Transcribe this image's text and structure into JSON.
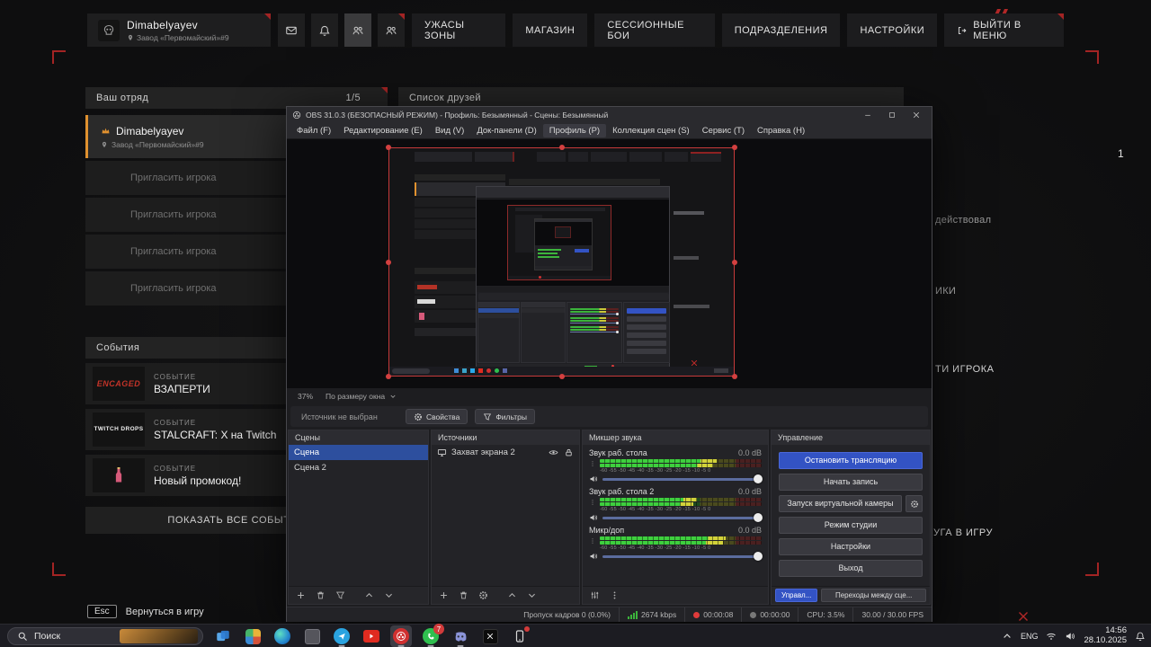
{
  "game": {
    "player_card": {
      "name": "Dimabelyayev",
      "location": "Завод «Первомайский»#9"
    },
    "top_nav": {
      "items": [
        "УЖАСЫ ЗОНЫ",
        "МАГАЗИН",
        "СЕССИОННЫЕ БОИ",
        "ПОДРАЗДЕЛЕНИЯ",
        "НАСТРОЙКИ",
        "ВЫЙТИ В МЕНЮ"
      ]
    },
    "squad": {
      "title": "Ваш отряд",
      "count": "1/5",
      "leader_name": "Dimabelyayev",
      "leader_location": "Завод «Первомайский»#9",
      "invite_label": "Пригласить игрока"
    },
    "friends_title": "Список друзей",
    "events": {
      "title": "События",
      "kind_label": "СОБЫТИЕ",
      "items": [
        {
          "badge": "ENCAGED",
          "title": "ВЗАПЕРТИ"
        },
        {
          "badge": "TWITCH DROPS",
          "title": "STALCRAFT: X на Twitch"
        },
        {
          "badge": "",
          "title": "Новый промокод!"
        }
      ],
      "show_all_label": "ПОКАЗАТЬ ВСЕ СОБЫТИЯ"
    },
    "fragments": {
      "friend_status": "действовал",
      "counter": "1",
      "tab_fragment": "ИКИ",
      "find_player": "ТИ ИГРОКА",
      "add_friend": "УГА В ИГРУ"
    },
    "footer": {
      "esc_key": "Esc",
      "return_label": "Вернуться в игру"
    }
  },
  "obs": {
    "window_title": "OBS 31.0.3 (БЕЗОПАСНЫЙ РЕЖИМ) - Профиль: Безымянный - Сцены: Безымянный",
    "menu": {
      "items": [
        "Файл (F)",
        "Редактирование (E)",
        "Вид (V)",
        "Док-панели (D)",
        "Профиль (P)",
        "Коллекция сцен (S)",
        "Сервис (T)",
        "Справка (H)"
      ]
    },
    "preview": {
      "zoom": "37%",
      "zoom_mode": "По размеру окна"
    },
    "source_toolbar": {
      "hint": "Источник не выбран",
      "properties_label": "Свойства",
      "filters_label": "Фильтры"
    },
    "scenes": {
      "title": "Сцены",
      "items": [
        "Сцена",
        "Сцена 2"
      ]
    },
    "sources": {
      "title": "Источники",
      "items": [
        "Захват экрана 2"
      ]
    },
    "mixer": {
      "title": "Микшер звука",
      "scale": "-60   -55   -50   -45   -40   -35   -30   -25   -20   -15   -10   -5    0",
      "channels": [
        {
          "name": "Звук раб. стола",
          "db": "0.0 dB"
        },
        {
          "name": "Звук раб. стола 2",
          "db": "0.0 dB"
        },
        {
          "name": "Микр/доп",
          "db": "0.0 dB"
        }
      ]
    },
    "controls": {
      "title": "Управление",
      "stop_stream": "Остановить трансляцию",
      "start_record": "Начать запись",
      "virtual_cam": "Запуск виртуальной камеры",
      "studio_mode": "Режим студии",
      "settings": "Настройки",
      "exit": "Выход",
      "manage": "Управл...",
      "transitions": "Переходы между сце..."
    },
    "status_bar": {
      "dropped_frames": "Пропуск кадров 0 (0.0%)",
      "bitrate": "2674 kbps",
      "stream_time": "00:00:08",
      "record_time": "00:00:00",
      "cpu": "CPU: 3.5%",
      "fps": "30.00 / 30.00 FPS"
    }
  },
  "taskbar": {
    "search_label": "Поиск",
    "whatsapp_badge": "7",
    "tray": {
      "lang": "ENG",
      "time": "14:56",
      "date": "28.10.2025"
    }
  },
  "colors": {
    "accent_orange": "#e0912f",
    "accent_red": "#a32424",
    "obs_blue": "#3353c4",
    "meter_green": "#3ecf3e",
    "selection_blue": "#2d4f9e"
  }
}
